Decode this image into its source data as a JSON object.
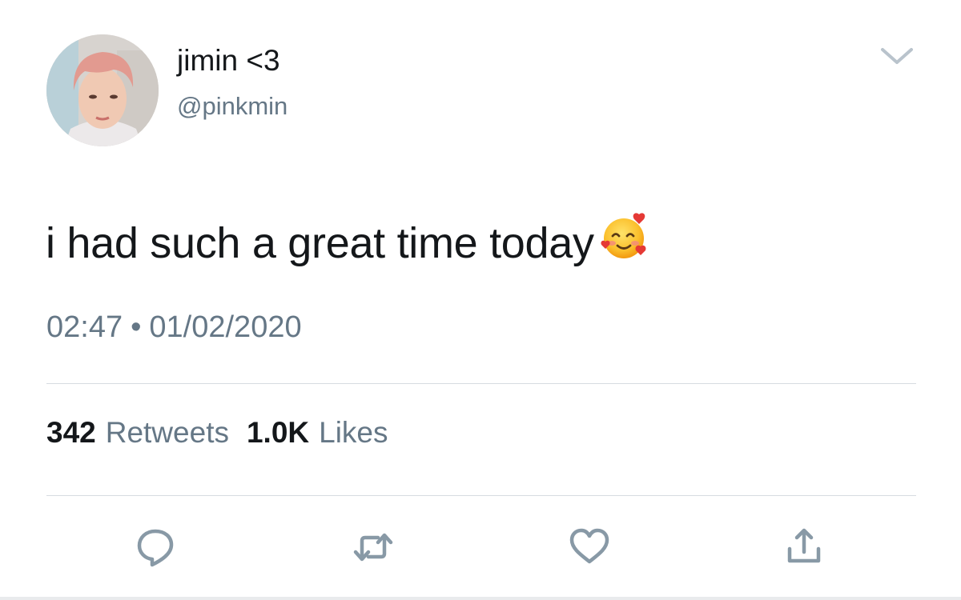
{
  "tweet": {
    "author": {
      "display_name": "jimin <3",
      "handle": "@pinkmin",
      "avatar_icon": "profile-photo"
    },
    "menu_icon": "chevron-down-icon",
    "text": "i had such a great time today",
    "emoji": "smiling-face-with-hearts",
    "time": "02:47",
    "separator": "•",
    "date": "01/02/2020",
    "stats": {
      "retweets_count": "342",
      "retweets_label": "Retweets",
      "likes_count": "1.0K",
      "likes_label": "Likes"
    },
    "actions": [
      {
        "name": "reply",
        "icon": "reply-icon"
      },
      {
        "name": "retweet",
        "icon": "retweet-icon"
      },
      {
        "name": "like",
        "icon": "heart-icon"
      },
      {
        "name": "share",
        "icon": "share-icon"
      }
    ]
  },
  "colors": {
    "text_primary": "#14171a",
    "text_secondary": "#657786",
    "icon_gray": "#8899a6",
    "divider": "#d6dce1",
    "accent_hair": "#e4968e"
  }
}
